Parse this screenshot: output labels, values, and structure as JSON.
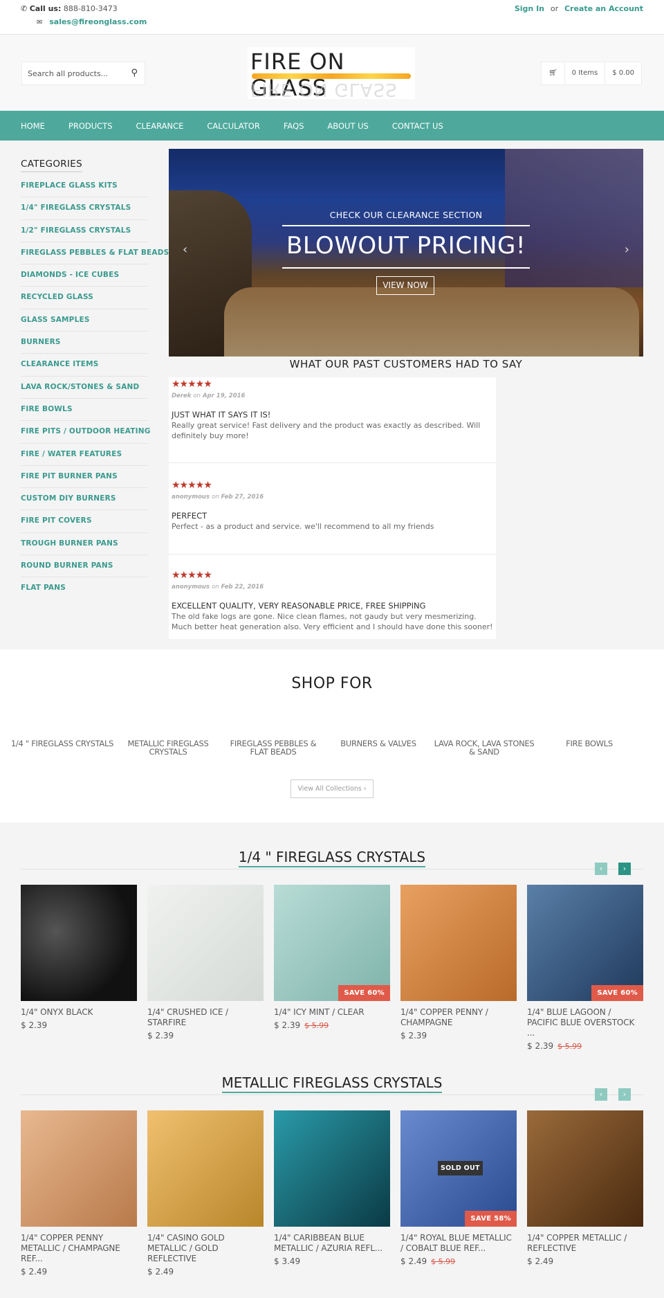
{
  "topbar": {
    "call_label": "Call us:",
    "phone": "888-810-3473",
    "email": "sales@fireonglass.com",
    "sign_in": "Sign In",
    "or": "or",
    "create_account": "Create an Account"
  },
  "header": {
    "search_placeholder": "Search all products...",
    "logo_text": "FIRE ON GLASS",
    "cart_items": "0 Items",
    "cart_total": "$ 0.00"
  },
  "nav": [
    "HOME",
    "PRODUCTS",
    "CLEARANCE",
    "CALCULATOR",
    "FAQS",
    "ABOUT US",
    "CONTACT US"
  ],
  "sidebar": {
    "title": "CATEGORIES",
    "items": [
      "FIREPLACE GLASS KITS",
      "1/4\" FIREGLASS CRYSTALS",
      "1/2\" FIREGLASS CRYSTALS",
      "FIREGLASS PEBBLES & FLAT BEADS",
      "DIAMONDS - ICE CUBES",
      "RECYCLED GLASS",
      "GLASS SAMPLES",
      "BURNERS",
      "CLEARANCE ITEMS",
      "LAVA ROCK/STONES & SAND",
      "FIRE BOWLS",
      "FIRE PITS / OUTDOOR HEATING",
      "FIRE / WATER FEATURES",
      "FIRE PIT BURNER PANS",
      "CUSTOM DIY BURNERS",
      "FIRE PIT COVERS",
      "TROUGH BURNER PANS",
      "ROUND BURNER PANS",
      "FLAT PANS"
    ]
  },
  "hero": {
    "subtitle": "CHECK OUR CLEARANCE SECTION",
    "title": "BLOWOUT PRICING!",
    "button": "VIEW NOW",
    "prev": "‹",
    "next": "›"
  },
  "testimonials": {
    "title": "WHAT OUR PAST CUSTOMERS HAD TO SAY",
    "reviews": [
      {
        "stars": "★★★★★",
        "rating": 5,
        "author": "Derek",
        "on": "on",
        "date": "Apr 19, 2016",
        "title": "JUST WHAT IT SAYS IT IS!",
        "body": "Really great service! Fast delivery and the product was exactly as described. Will definitely buy more!"
      },
      {
        "stars": "★★★★★",
        "rating": 5,
        "author": "anonymous",
        "on": "on",
        "date": "Feb 27, 2016",
        "title": "PERFECT",
        "body": "Perfect - as a product and service. we'll recommend to all my friends"
      },
      {
        "stars": "★★★★★",
        "rating": 5,
        "author": "anonymous",
        "on": "on",
        "date": "Feb 22, 2016",
        "title": "EXCELLENT QUALITY, VERY REASONABLE PRICE, FREE SHIPPING",
        "body": "The old fake logs are gone. Nice clean flames, not gaudy but very mesmerizing. Much better heat generation also. Very efficient and I should have done this sooner!"
      }
    ]
  },
  "shop_for": {
    "title": "SHOP FOR",
    "categories": [
      "1/4 \" FIREGLASS CRYSTALS",
      "METALLIC FIREGLASS CRYSTALS",
      "FIREGLASS PEBBLES & FLAT BEADS",
      "BURNERS & VALVES",
      "LAVA ROCK, LAVA STONES & SAND",
      "FIRE BOWLS"
    ],
    "view_all": "View All Collections ›"
  },
  "collections": [
    {
      "title": "1/4 \" FIREGLASS CRYSTALS",
      "prev": "‹",
      "next": "›",
      "products": [
        {
          "name": "1/4\" ONYX BLACK",
          "price": "$ 2.39",
          "old_price": "",
          "badge": "",
          "sold_out": ""
        },
        {
          "name": "1/4\" CRUSHED ICE / STARFIRE",
          "price": "$ 2.39",
          "old_price": "",
          "badge": "",
          "sold_out": ""
        },
        {
          "name": "1/4\" ICY MINT / CLEAR",
          "price": "$ 2.39",
          "old_price": "$ 5.99",
          "badge": "SAVE 60%",
          "sold_out": ""
        },
        {
          "name": "1/4\" COPPER PENNY / CHAMPAGNE",
          "price": "$ 2.39",
          "old_price": "",
          "badge": "",
          "sold_out": ""
        },
        {
          "name": "1/4\" BLUE LAGOON / PACIFIC BLUE OVERSTOCK ...",
          "price": "$ 2.39",
          "old_price": "$ 5.99",
          "badge": "SAVE 60%",
          "sold_out": ""
        }
      ]
    },
    {
      "title": "METALLIC FIREGLASS CRYSTALS",
      "prev": "‹",
      "next": "›",
      "products": [
        {
          "name": "1/4\" COPPER PENNY METALLIC / CHAMPAGNE REF...",
          "price": "$ 2.49",
          "old_price": "",
          "badge": "",
          "sold_out": ""
        },
        {
          "name": "1/4\" CASINO GOLD METALLIC / GOLD REFLECTIVE",
          "price": "$ 2.49",
          "old_price": "",
          "badge": "",
          "sold_out": ""
        },
        {
          "name": "1/4\" CARIBBEAN BLUE METALLIC / AZURIA REFL...",
          "price": "$ 3.49",
          "old_price": "",
          "badge": "",
          "sold_out": ""
        },
        {
          "name": "1/4\" ROYAL BLUE METALLIC / COBALT BLUE REF...",
          "price": "$ 2.49",
          "old_price": "$ 5.99",
          "badge": "SAVE 58%",
          "sold_out": "SOLD OUT"
        },
        {
          "name": "1/4\" COPPER METALLIC / REFLECTIVE",
          "price": "$ 2.49",
          "old_price": "",
          "badge": "",
          "sold_out": ""
        }
      ]
    }
  ],
  "colors": {
    "accent": "#4ea99c",
    "link": "#3a9a8e",
    "sale": "#e05a4a",
    "stars": "#c0392b"
  }
}
